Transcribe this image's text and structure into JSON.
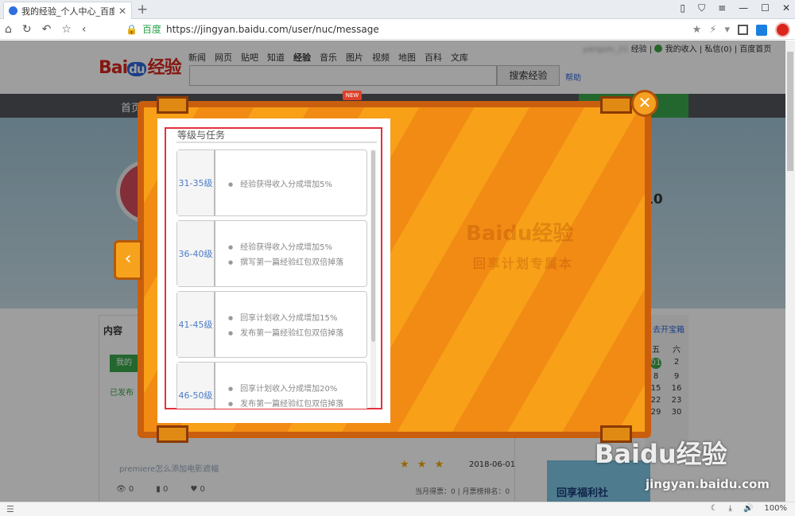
{
  "browser": {
    "tab_title": "我的经验_个人中心_百度经验",
    "url_secure_label": "百度",
    "url": "https://jingyan.baidu.com/user/nuc/message",
    "zoom": "100%"
  },
  "site": {
    "logo_bai": "Bai",
    "logo_du": "du",
    "logo_jy": "经验",
    "nav": [
      "新闻",
      "网页",
      "贴吧",
      "知道",
      "经验",
      "音乐",
      "图片",
      "视频",
      "地图",
      "百科",
      "文库"
    ],
    "search_button": "搜索经验",
    "help": "帮助",
    "user_name": "yangxin_21",
    "user_center": "经验",
    "my_income": "我的收入",
    "messages": "私信(0)",
    "home": "百度首页"
  },
  "page": {
    "nav_home": "首页",
    "stat_value": "10",
    "content_title": "内容",
    "my_btn": "我的",
    "published": "已发布",
    "article_title": "premiere怎么添加电影遮幅",
    "stars": "★ ★ ★",
    "date": "2018-06-01",
    "count_views": "0",
    "count_votes": "0",
    "count_likes": "0",
    "rank_text": "当月得票：0 | 月票榜排名：0",
    "calendar_link": "去开宝箱",
    "calendar_head": [
      "五",
      "六"
    ],
    "calendar_days": [
      "01",
      "2",
      "8",
      "9",
      "15",
      "16",
      "22",
      "23",
      "29",
      "30"
    ],
    "fuli": "回享福利社"
  },
  "modal": {
    "new_badge": "NEW",
    "close_icon": "✕",
    "prev_icon": "‹",
    "watermark_logo": "Baidu经验",
    "watermark_sub": "回享计划专属本",
    "panel_title": "等级与任务",
    "levels": [
      {
        "range": "31-35级",
        "tasks": [
          "经验获得收入分成增加5%"
        ]
      },
      {
        "range": "36-40级",
        "tasks": [
          "经验获得收入分成增加5%",
          "撰写第一篇经验红包双倍掉落"
        ]
      },
      {
        "range": "41-45级",
        "tasks": [
          "回享计划收入分成增加15%",
          "发布第一篇经验红包双倍掉落"
        ]
      },
      {
        "range": "46-50级",
        "tasks": [
          "回享计划收入分成增加20%",
          "发布第一篇经验红包双倍掉落"
        ]
      }
    ]
  },
  "watermark": {
    "text": "Baidu经验",
    "url": "jingyan.baidu.com"
  }
}
